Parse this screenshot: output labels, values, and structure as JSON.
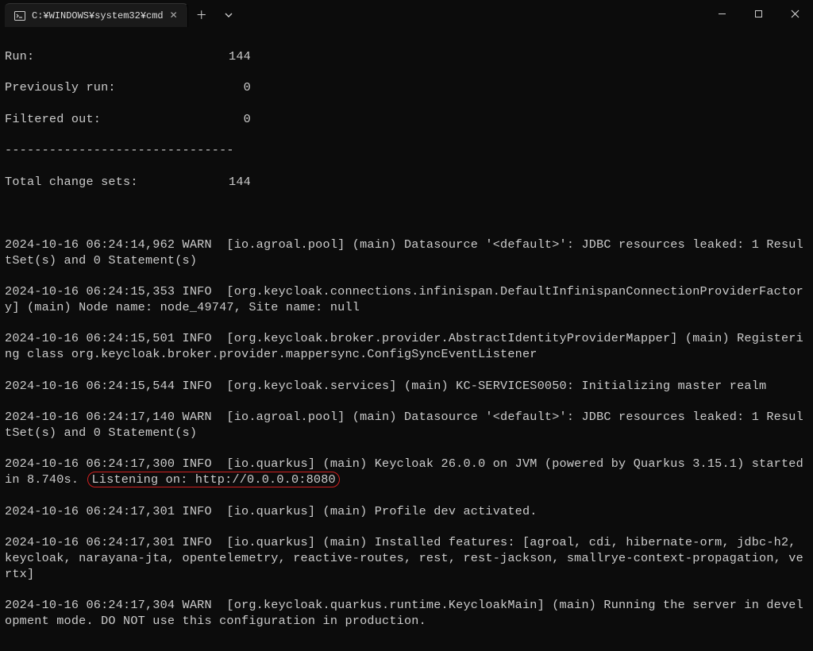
{
  "titlebar": {
    "tab_label": "C:¥WINDOWS¥system32¥cmd"
  },
  "stats": {
    "run_label": "Run:",
    "run_value": "144",
    "prev_label": "Previously run:",
    "prev_value": "0",
    "filtered_label": "Filtered out:",
    "filtered_value": "0",
    "sep": "-------------------------------",
    "total_label": "Total change sets:",
    "total_value": "144"
  },
  "logs": {
    "l1": "2024-10-16 06:24:14,962 WARN  [io.agroal.pool] (main) Datasource '<default>': JDBC resources leaked: 1 ResultSet(s) and 0 Statement(s)",
    "l2": "2024-10-16 06:24:15,353 INFO  [org.keycloak.connections.infinispan.DefaultInfinispanConnectionProviderFactory] (main) Node name: node_49747, Site name: null",
    "l3": "2024-10-16 06:24:15,501 INFO  [org.keycloak.broker.provider.AbstractIdentityProviderMapper] (main) Registering class org.keycloak.broker.provider.mappersync.ConfigSyncEventListener",
    "l4": "2024-10-16 06:24:15,544 INFO  [org.keycloak.services] (main) KC-SERVICES0050: Initializing master realm",
    "l5": "2024-10-16 06:24:17,140 WARN  [io.agroal.pool] (main) Datasource '<default>': JDBC resources leaked: 1 ResultSet(s) and 0 Statement(s)",
    "l6_prefix": "2024-10-16 06:24:17,300 INFO  [io.quarkus] (main) Keycloak 26.0.0 on JVM (powered by Quarkus 3.15.1) started in 8.740s.",
    "l6_highlight": "Listening on: http://0.0.0.0:8080",
    "l7": "2024-10-16 06:24:17,301 INFO  [io.quarkus] (main) Profile dev activated.",
    "l8": "2024-10-16 06:24:17,301 INFO  [io.quarkus] (main) Installed features: [agroal, cdi, hibernate-orm, jdbc-h2, keycloak, narayana-jta, opentelemetry, reactive-routes, rest, rest-jackson, smallrye-context-propagation, vertx]",
    "l9": "2024-10-16 06:24:17,304 WARN  [org.keycloak.quarkus.runtime.KeycloakMain] (main) Running the server in development mode. DO NOT use this configuration in production."
  }
}
